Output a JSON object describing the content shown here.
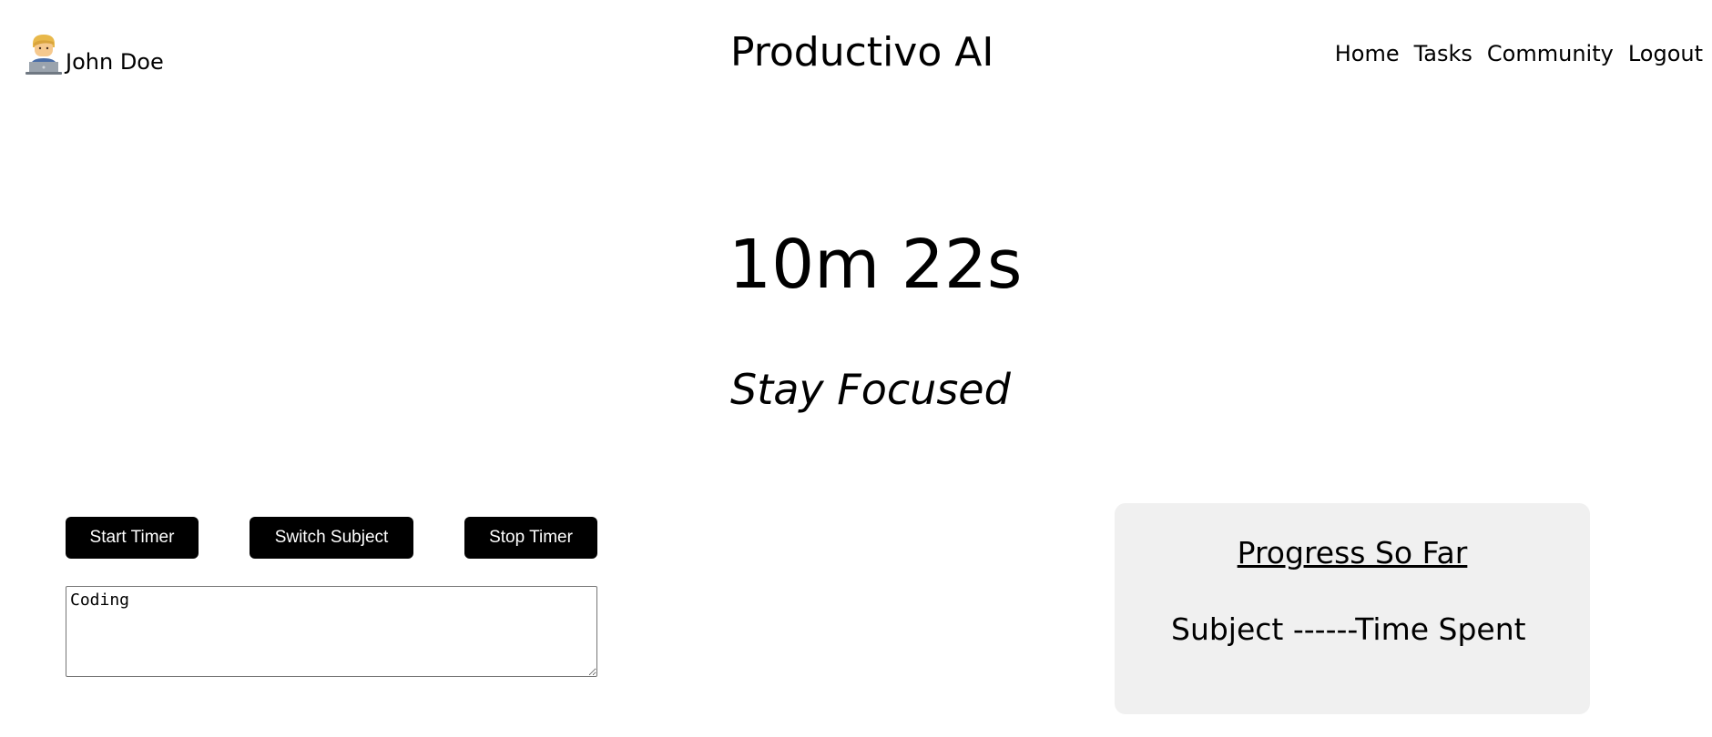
{
  "header": {
    "user_name": "John Doe",
    "avatar_icon": "technologist-icon",
    "app_title": "Productivo AI",
    "nav": [
      {
        "label": "Home"
      },
      {
        "label": "Tasks"
      },
      {
        "label": "Community"
      },
      {
        "label": "Logout"
      }
    ]
  },
  "timer": {
    "display": "10m 22s",
    "motto": "Stay Focused"
  },
  "controls": {
    "start_label": "Start Timer",
    "switch_label": "Switch Subject",
    "stop_label": "Stop Timer",
    "subject_value": "Coding"
  },
  "progress": {
    "title": "Progress So Far",
    "header_text": "Subject ------Time Spent"
  },
  "colors": {
    "button_bg": "#000000",
    "button_text": "#ffffff",
    "panel_bg": "#f0f0f0"
  }
}
